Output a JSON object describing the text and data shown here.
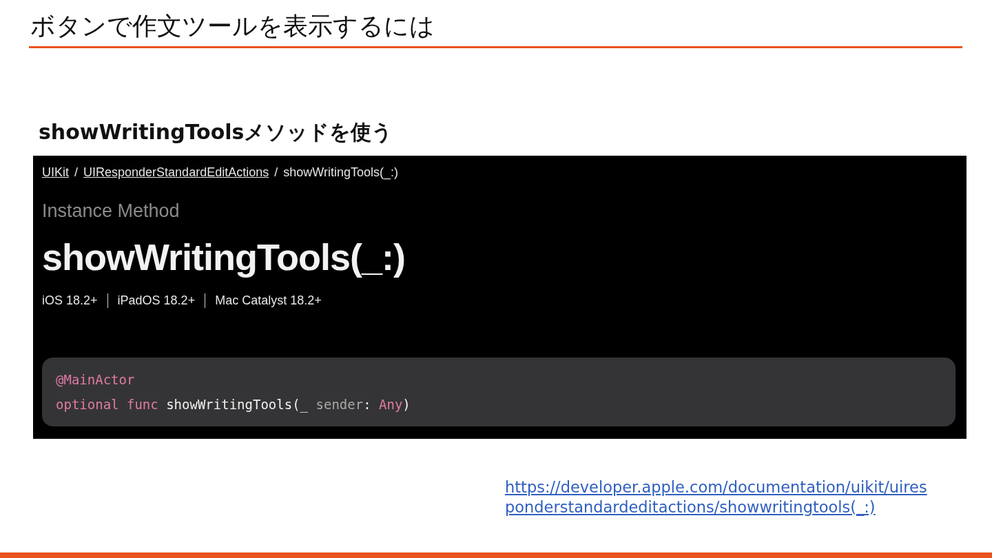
{
  "title": "ボタンで作文ツールを表示するには",
  "subtitle": "showWritingToolsメソッドを使う",
  "screenshot": {
    "breadcrumbs": [
      {
        "label": "UIKit",
        "kind": "link"
      },
      {
        "label": "/",
        "kind": "separator"
      },
      {
        "label": "UIResponderStandardEditActions",
        "kind": "link"
      },
      {
        "label": "/",
        "kind": "separator"
      },
      {
        "label": "showWritingTools(_:)",
        "kind": "current"
      }
    ],
    "kicker": "Instance Method",
    "heading": "showWritingTools(_:)",
    "platforms": [
      "iOS 18.2+",
      "iPadOS 18.2+",
      "Mac Catalyst 18.2+"
    ],
    "code": [
      [
        {
          "text": "@MainActor",
          "kind": "keyword"
        }
      ],
      [
        {
          "text": "optional",
          "kind": "keyword"
        },
        {
          "text": " func",
          "kind": "keyword"
        },
        {
          "text": " showWritingTools(_ ",
          "kind": "plain"
        },
        {
          "text": "sender",
          "kind": "param"
        },
        {
          "text": ": ",
          "kind": "plain"
        },
        {
          "text": "Any",
          "kind": "keyword"
        },
        {
          "text": ")",
          "kind": "plain"
        }
      ]
    ]
  },
  "link": "https://developer.apple.com/documentation/uikit/uiresponderstandardeditactions/showwritingtools(_:)"
}
